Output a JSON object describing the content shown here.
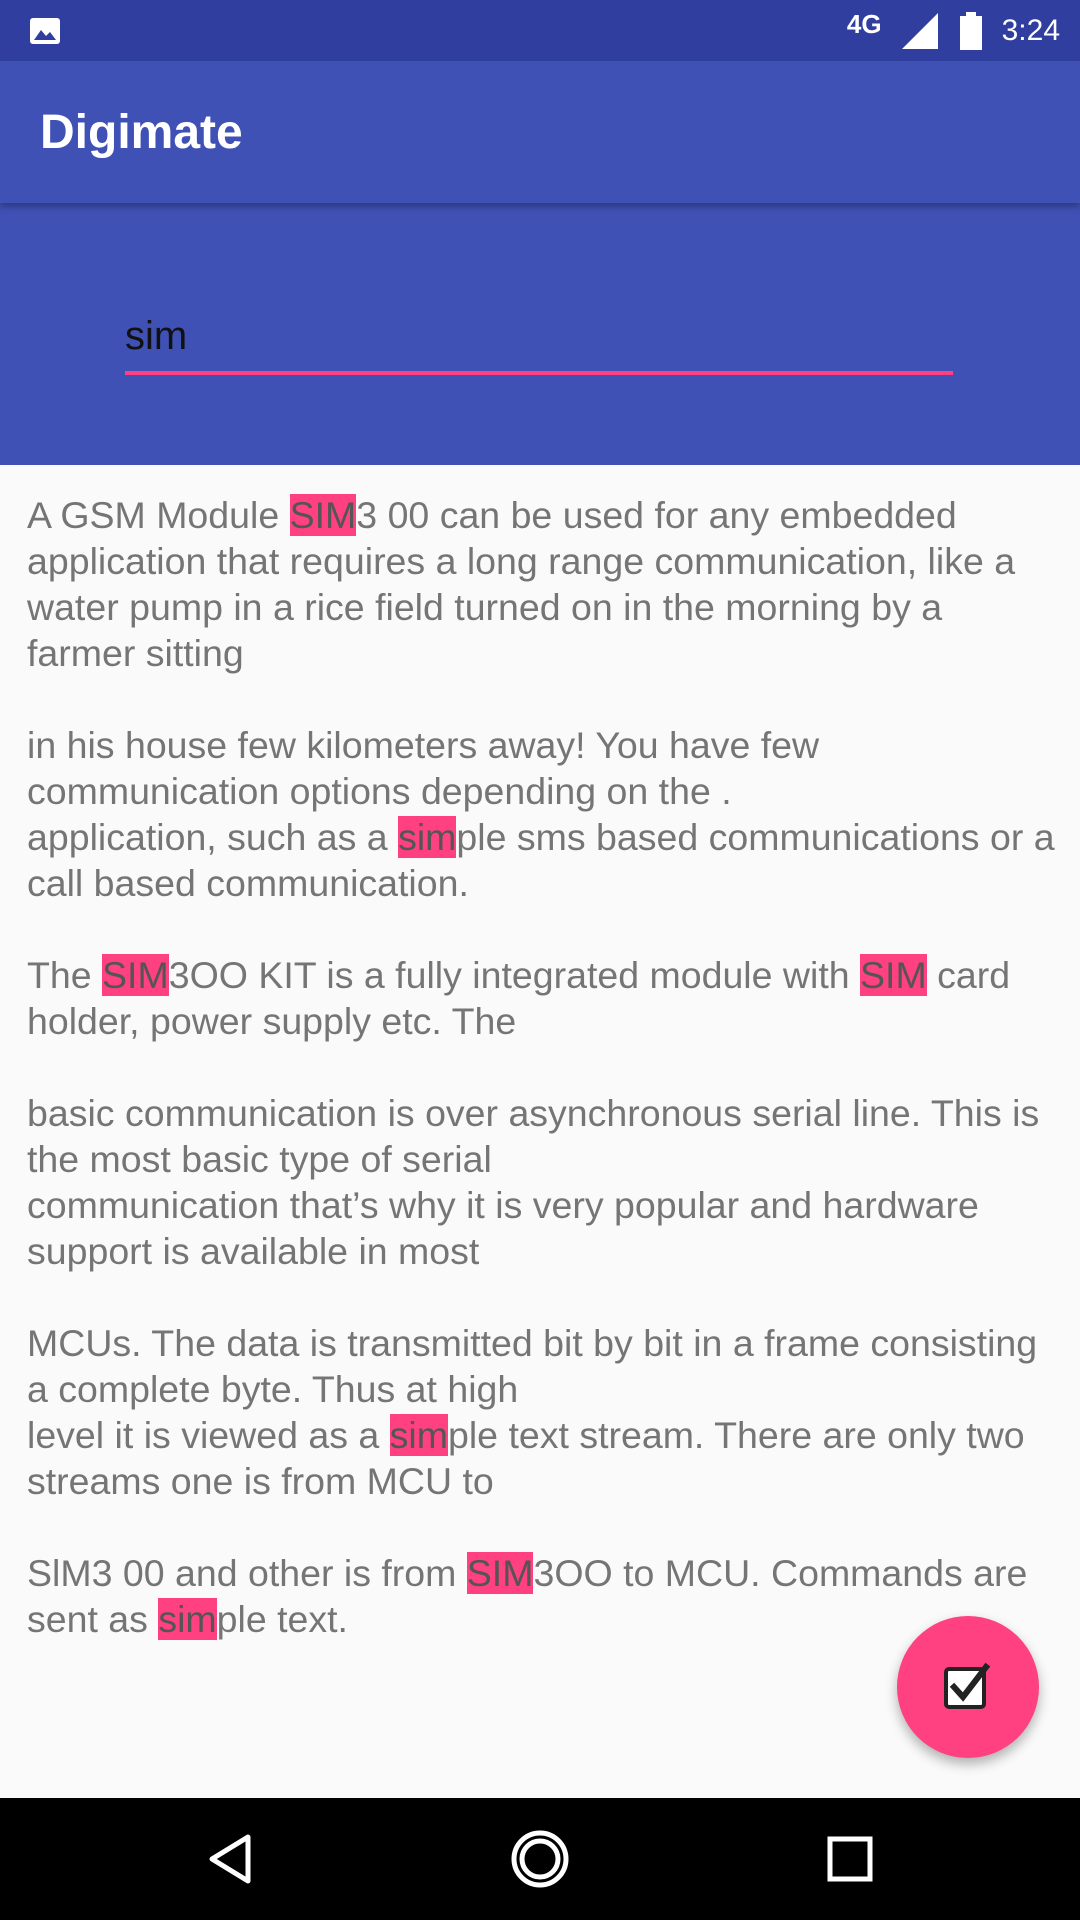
{
  "status_bar": {
    "network": "4G",
    "time": "3:24",
    "icons": [
      "image-icon",
      "signal-icon",
      "battery-icon"
    ]
  },
  "app_bar": {
    "title": "Digimate"
  },
  "search": {
    "value": "sim"
  },
  "content": {
    "highlight_color": "#FF4081",
    "paragraphs": [
      [
        {
          "text": "A GSM Module "
        },
        {
          "text": "SIM",
          "hl": true
        },
        {
          "text": "3 00 can be used for any embedded application that requires a long range communication, like a water pump in a rice field turned on in the morning by a farmer sitting"
        }
      ],
      [
        {
          "text": "in his house few kilometers away! You have few communication options depending on the .\napplication, such as a "
        },
        {
          "text": "sim",
          "hl": true
        },
        {
          "text": "ple sms based communications or a call based communication."
        }
      ],
      [
        {
          "text": "The "
        },
        {
          "text": "SIM",
          "hl": true
        },
        {
          "text": "3OO KIT is a fully integrated module with "
        },
        {
          "text": "SIM",
          "hl": true
        },
        {
          "text": " card holder, power supply etc. The"
        }
      ],
      [
        {
          "text": "basic communication is over asynchronous serial line. This is the most basic type of serial\ncommunication that’s why it is very popular and hardware support is available in most"
        }
      ],
      [
        {
          "text": "MCUs. The data is transmitted bit by bit in a frame consisting a complete byte. Thus at high\nlevel it is viewed as a "
        },
        {
          "text": "sim",
          "hl": true
        },
        {
          "text": "ple text stream. There are only two streams one is from MCU to"
        }
      ],
      [
        {
          "text": "SlM3 00 and other is from "
        },
        {
          "text": "SIM",
          "hl": true
        },
        {
          "text": "3OO to MCU. Commands are sent as "
        },
        {
          "text": "sim",
          "hl": true
        },
        {
          "text": "ple text."
        }
      ]
    ]
  },
  "fab": {
    "icon": "checkbox-icon"
  },
  "nav_bar": {
    "buttons": [
      "back-icon",
      "home-icon",
      "recents-icon"
    ]
  }
}
